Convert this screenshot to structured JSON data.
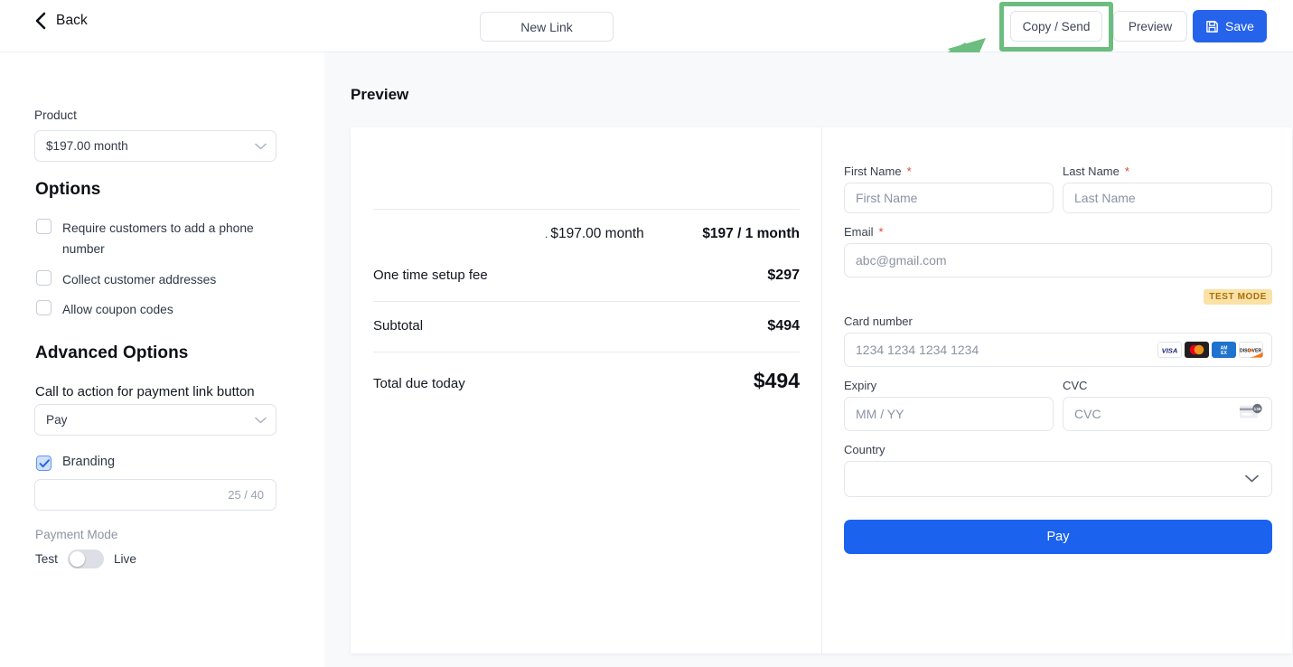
{
  "topbar": {
    "back_label": "Back",
    "new_link_label": "New Link",
    "copy_send_label": "Copy / Send",
    "preview_label": "Preview",
    "save_label": "Save"
  },
  "sidebar": {
    "product_label": "Product",
    "product_value": "$197.00 month",
    "options_heading": "Options",
    "options": [
      {
        "label": "Require customers to add a phone number",
        "checked": false
      },
      {
        "label": "Collect customer addresses",
        "checked": false
      },
      {
        "label": "Allow coupon codes",
        "checked": false
      }
    ],
    "advanced_heading": "Advanced Options",
    "cta_label": "Call to action for payment link button",
    "cta_value": "Pay",
    "branding_label": "Branding",
    "branding_checked": true,
    "branding_counter": "25 / 40",
    "payment_mode_label": "Payment Mode",
    "mode_test": "Test",
    "mode_live": "Live",
    "mode_selected": "Test"
  },
  "main": {
    "preview_title": "Preview",
    "invoice": {
      "line_item_dot": ".",
      "line_item_name": "$197.00 month",
      "line_item_price": "$197 / 1 month",
      "rows": [
        {
          "label": "One time setup fee",
          "value": "$297"
        },
        {
          "label": "Subtotal",
          "value": "$494"
        }
      ],
      "total_label": "Total due today",
      "total_value": "$494"
    },
    "payment_form": {
      "first_name_label": "First Name",
      "first_name_placeholder": "First Name",
      "first_name_value": "",
      "last_name_label": "Last Name",
      "last_name_placeholder": "Last Name",
      "last_name_value": "",
      "email_label": "Email",
      "email_placeholder": "abc@gmail.com",
      "email_value": "",
      "required_mark": "*",
      "test_mode_badge": "TEST MODE",
      "card_number_label": "Card number",
      "card_number_placeholder": "1234 1234 1234 1234",
      "card_number_value": "",
      "card_brands": [
        "visa",
        "mastercard",
        "amex",
        "discover"
      ],
      "expiry_label": "Expiry",
      "expiry_placeholder": "MM / YY",
      "expiry_value": "",
      "cvc_label": "CVC",
      "cvc_placeholder": "CVC",
      "cvc_value": "",
      "cvc_hint_number": "135",
      "country_label": "Country",
      "country_value": "",
      "pay_button_label": "Pay"
    }
  },
  "annotation": {
    "highlight_color": "#6cbd80",
    "arrow_color": "#6cbd80",
    "target": "Copy / Send"
  },
  "colors": {
    "accent_blue": "#2563eb",
    "pay_blue": "#1b63ef",
    "page_bg": "#f8f9fb",
    "checkbox_checked_bg": "#cfe0fb",
    "test_mode_bg": "#fae1a6",
    "test_mode_text": "#a8700c"
  }
}
